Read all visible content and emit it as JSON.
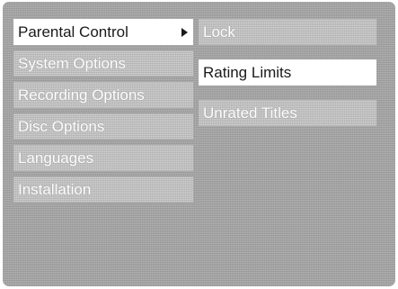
{
  "main_menu": {
    "items": [
      {
        "label": "Parental Control",
        "selected": true,
        "has_submenu": true
      },
      {
        "label": "System Options"
      },
      {
        "label": "Recording Options"
      },
      {
        "label": "Disc Options"
      },
      {
        "label": "Languages"
      },
      {
        "label": "Installation"
      }
    ]
  },
  "submenu": {
    "items": [
      {
        "label": "Lock"
      },
      {
        "label": "Rating Limits",
        "selected": true
      },
      {
        "label": "Unrated Titles"
      }
    ]
  },
  "icons": {
    "submenu_indicator": "triangle-right-icon"
  },
  "colors": {
    "selected_background": "#ffffff",
    "selected_text": "#1a1a1a",
    "item_text": "#ffffff",
    "item_background": "#cfcfcf",
    "screen_background": "#a8a8a8"
  }
}
